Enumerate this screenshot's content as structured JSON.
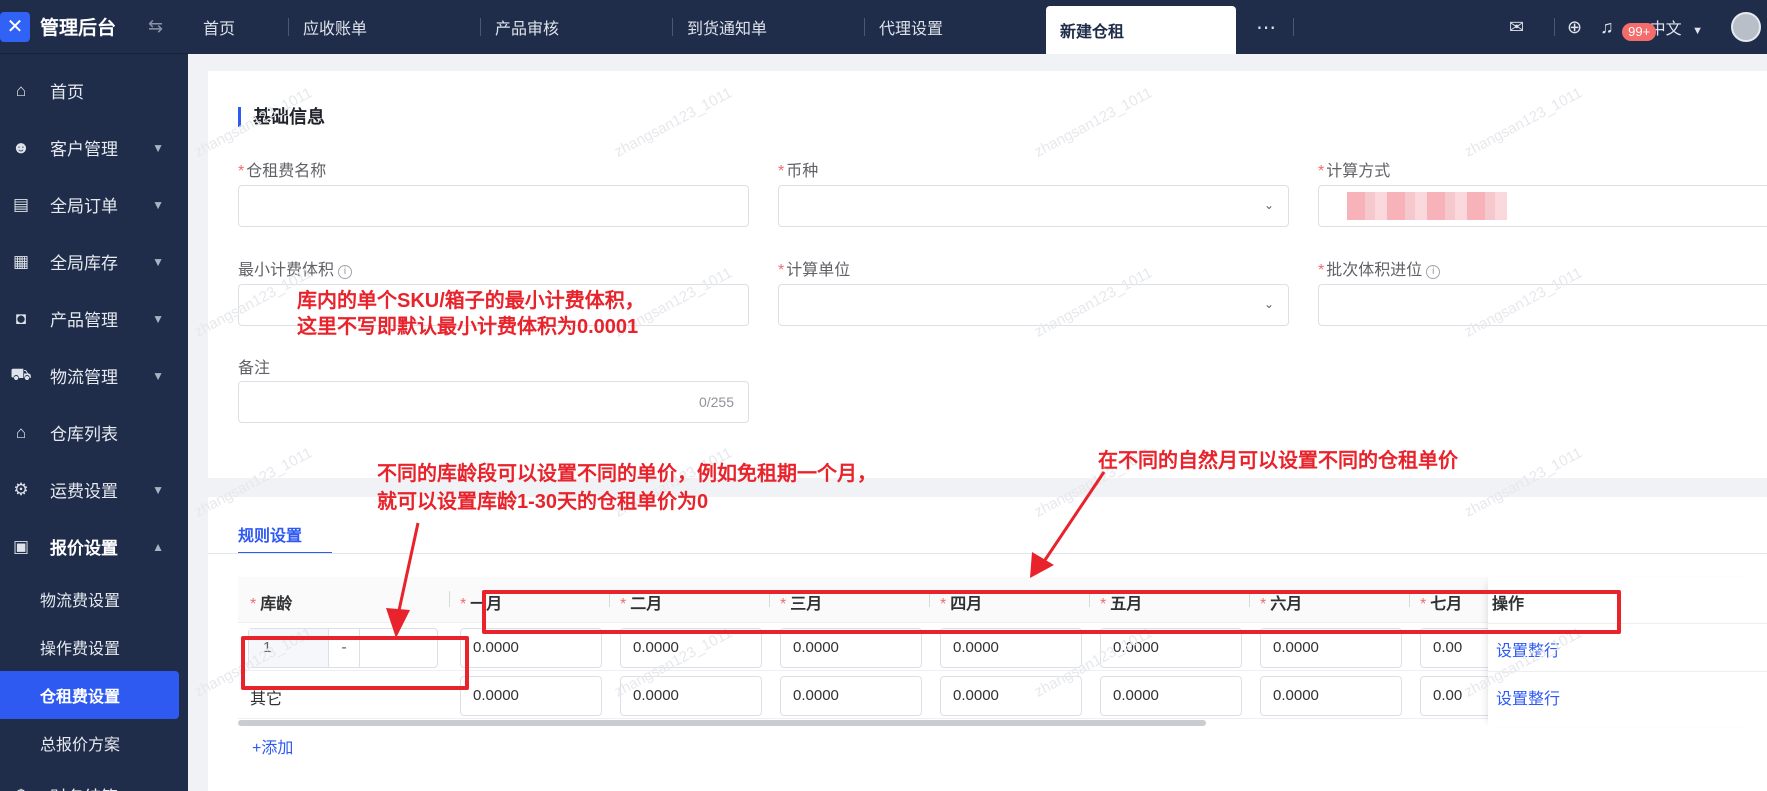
{
  "app": {
    "title": "管理后台"
  },
  "sidebar": {
    "items": [
      {
        "label": "首页",
        "icon": "home-icon",
        "glyph": "⌂"
      },
      {
        "label": "客户管理",
        "icon": "users-icon",
        "glyph": "☻"
      },
      {
        "label": "全局订单",
        "icon": "clipboard-icon",
        "glyph": "▤"
      },
      {
        "label": "全局库存",
        "icon": "warehouse-icon",
        "glyph": "▦"
      },
      {
        "label": "产品管理",
        "icon": "bag-icon",
        "glyph": "◘"
      },
      {
        "label": "物流管理",
        "icon": "truck-icon",
        "glyph": "⛟"
      },
      {
        "label": "仓库列表",
        "icon": "house-icon",
        "glyph": "⌂"
      },
      {
        "label": "运费设置",
        "icon": "box-gear-icon",
        "glyph": "⚙"
      },
      {
        "label": "报价设置",
        "icon": "document-icon",
        "glyph": "▣"
      }
    ],
    "submenu": [
      "物流费设置",
      "操作费设置",
      "仓租费设置",
      "总报价方案"
    ],
    "partial_item": {
      "label": "财务结算",
      "icon": "finance-icon",
      "glyph": "$"
    }
  },
  "tabs": [
    "首页",
    "应收账单",
    "产品审核",
    "到货通知单",
    "代理设置",
    "新建仓租"
  ],
  "top_right": {
    "badge": "99+",
    "language": "中文"
  },
  "basic_info": {
    "title": "基础信息",
    "fields": {
      "name": {
        "label": "仓租费名称",
        "value": ""
      },
      "currency": {
        "label": "币种",
        "value": ""
      },
      "method": {
        "label": "计算方式",
        "value": ""
      },
      "min_volume": {
        "label": "最小计费体积",
        "value": ""
      },
      "unit": {
        "label": "计算单位",
        "value": ""
      },
      "batch_round": {
        "label": "批次体积进位",
        "value": ""
      },
      "remark": {
        "label": "备注",
        "value": "",
        "counter": "0/255"
      }
    }
  },
  "rules": {
    "tab_label": "规则设置",
    "columns": {
      "age": "库龄",
      "months": [
        "一月",
        "二月",
        "三月",
        "四月",
        "五月",
        "六月",
        "七月"
      ],
      "action": "操作"
    },
    "rows": [
      {
        "age_from": "1",
        "age_to": "",
        "values": [
          "0.0000",
          "0.0000",
          "0.0000",
          "0.0000",
          "0.0000",
          "0.0000",
          "0.00"
        ],
        "action": "设置整行"
      },
      {
        "label": "其它",
        "values": [
          "0.0000",
          "0.0000",
          "0.0000",
          "0.0000",
          "0.0000",
          "0.0000",
          "0.00"
        ],
        "action": "设置整行"
      }
    ],
    "age_separator": "-",
    "add_label": "+添加"
  },
  "watermark": "zhangsan123_1011",
  "annotations": {
    "min_volume_note": [
      "库内的单个SKU/箱子的最小计费体积，",
      "这里不写即默认最小计费体积为0.0001"
    ],
    "age_note": [
      "不同的库龄段可以设置不同的单价，例如免租期一个月，",
      "就可以设置库龄1-30天的仓租单价为0"
    ],
    "month_note": "在不同的自然月可以设置不同的仓租单价",
    "color": "#e8232b"
  },
  "colors": {
    "sidebar_bg": "#1f2d4a",
    "accent": "#2f5af2",
    "required": "#f56c6c"
  }
}
